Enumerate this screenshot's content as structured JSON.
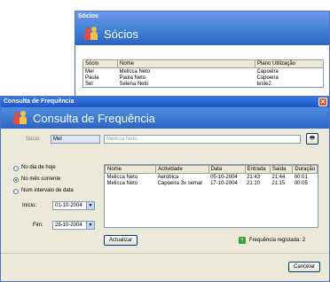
{
  "socios_window": {
    "title": "Sócios",
    "header_title": "Sócios",
    "columns": [
      "Sócio",
      "Nome",
      "Plano Utilização"
    ],
    "rows": [
      [
        "Mel",
        "Melicca Neto",
        "Capoeira"
      ],
      [
        "Paula",
        "Paula Neto",
        "Capoeira"
      ],
      [
        "Sel",
        "Selena Neto",
        "teste2"
      ]
    ]
  },
  "freq_window": {
    "title": "Consulta de Frequência",
    "header_title": "Consulta de Frequência",
    "socio_label": "Sócio:",
    "socio_code": "Mel",
    "socio_name": "Melicca Neto",
    "options": [
      {
        "label": "No dia de hoje",
        "selected": false
      },
      {
        "label": "No mês corrente",
        "selected": true
      },
      {
        "label": "Num intervalo de data",
        "selected": false
      }
    ],
    "inicio_label": "Início:",
    "inicio_value": "01-10-2004",
    "fim_label": "Fim:",
    "fim_value": "28-10-2004",
    "columns": [
      "Nome",
      "Actividade",
      "Data",
      "Entrada",
      "Saída",
      "Duração"
    ],
    "rows": [
      [
        "Melicca Neto",
        "Aeróbica",
        "05-10-2004",
        "21:43",
        "21:44",
        "00:01"
      ],
      [
        "Melicca Neto",
        "Capoeira 3x semar",
        "17-10-2004",
        "21:10",
        "21:15",
        "00:05"
      ]
    ],
    "actualizar_label": "Actualizar",
    "status_text": "Frequência registada: 2",
    "cancel_label": "Cancelar"
  }
}
